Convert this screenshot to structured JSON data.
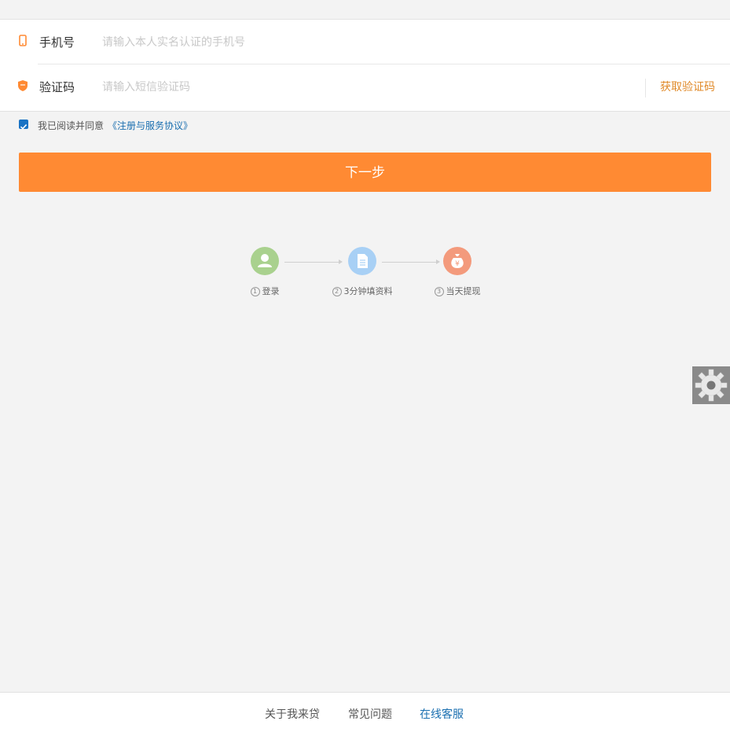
{
  "form": {
    "phone": {
      "label": "手机号",
      "placeholder": "请输入本人实名认证的手机号",
      "value": ""
    },
    "code": {
      "label": "验证码",
      "placeholder": "请输入短信验证码",
      "value": "",
      "get_code_label": "获取验证码"
    }
  },
  "agreement": {
    "checked": true,
    "text": "我已阅读并同意",
    "link_text": "《注册与服务协议》"
  },
  "next_button": {
    "label": "下一步"
  },
  "steps": [
    {
      "num": "1",
      "label": "登录",
      "color": "#a9d18e",
      "icon": "user-icon"
    },
    {
      "num": "2",
      "label": "3分钟填资料",
      "color": "#a8d0f5",
      "icon": "document-icon"
    },
    {
      "num": "3",
      "label": "当天提现",
      "color": "#f39a7c",
      "icon": "money-bag-icon"
    }
  ],
  "footer": {
    "links": [
      {
        "label": "关于我来贷",
        "active": false
      },
      {
        "label": "常见问题",
        "active": false
      },
      {
        "label": "在线客服",
        "active": true
      }
    ]
  },
  "colors": {
    "accent": "#ff8a33",
    "link": "#1a6fb0",
    "get_code": "#e08a2a"
  }
}
